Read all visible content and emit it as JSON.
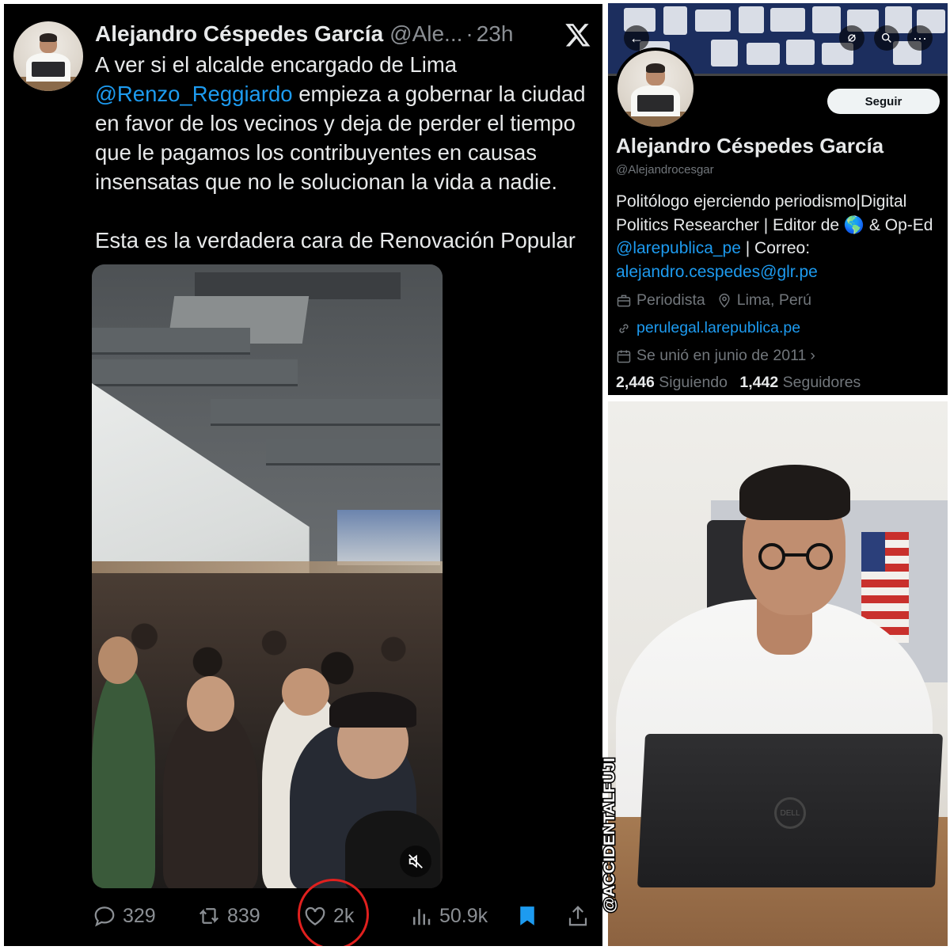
{
  "tweet": {
    "author_name": "Alejandro Céspedes García",
    "author_handle": "@Ale...",
    "separator": "·",
    "time": "23h",
    "text_line1_prefix": "A ver si el alcalde encargado de Lima",
    "mention": "@Renzo_Reggiardo",
    "text_line2_suffix": " empieza a gobernar la ciudad en favor de los vecinos y deja de perder el tiempo que le pagamos los contribuyentes en causas insensatas que no le solucionan la vida a nadie.",
    "text_paragraph2": "Esta es la verdadera cara de Renovación Popular",
    "actions": {
      "replies": "329",
      "reposts": "839",
      "likes": "2k",
      "views": "50.9k"
    },
    "icons": [
      "x-logo-icon",
      "mute-icon",
      "reply-icon",
      "repost-icon",
      "like-icon",
      "views-icon",
      "bookmark-icon",
      "share-icon"
    ],
    "highlight_color": "#e0201e"
  },
  "profile": {
    "follow_label": "Seguir",
    "name": "Alejandro Céspedes García",
    "handle": "@Alejandrocesgar",
    "bio_part1": "Politólogo ejerciendo periodismo|Digital Politics Researcher | Editor de",
    "bio_globe": "🌎",
    "bio_part2": " & Op-Ed ",
    "bio_link": "@larepublica_pe",
    "bio_part3": " | Correo: ",
    "bio_email": "alejandro.cespedes@glr.pe",
    "occupation": "Periodista",
    "location": "Lima, Perú",
    "website": "perulegal.larepublica.pe",
    "joined": "Se unió en junio de 2011",
    "joined_chevron": "›",
    "following_count": "2,446",
    "following_label": "Siguiendo",
    "followers_count": "1,442",
    "followers_label": "Seguidores",
    "nav_back": "←",
    "nav_more": "···"
  },
  "watermark": "@ACCIDENTALFUJI",
  "photo": {
    "laptop_logo": "DELL"
  }
}
